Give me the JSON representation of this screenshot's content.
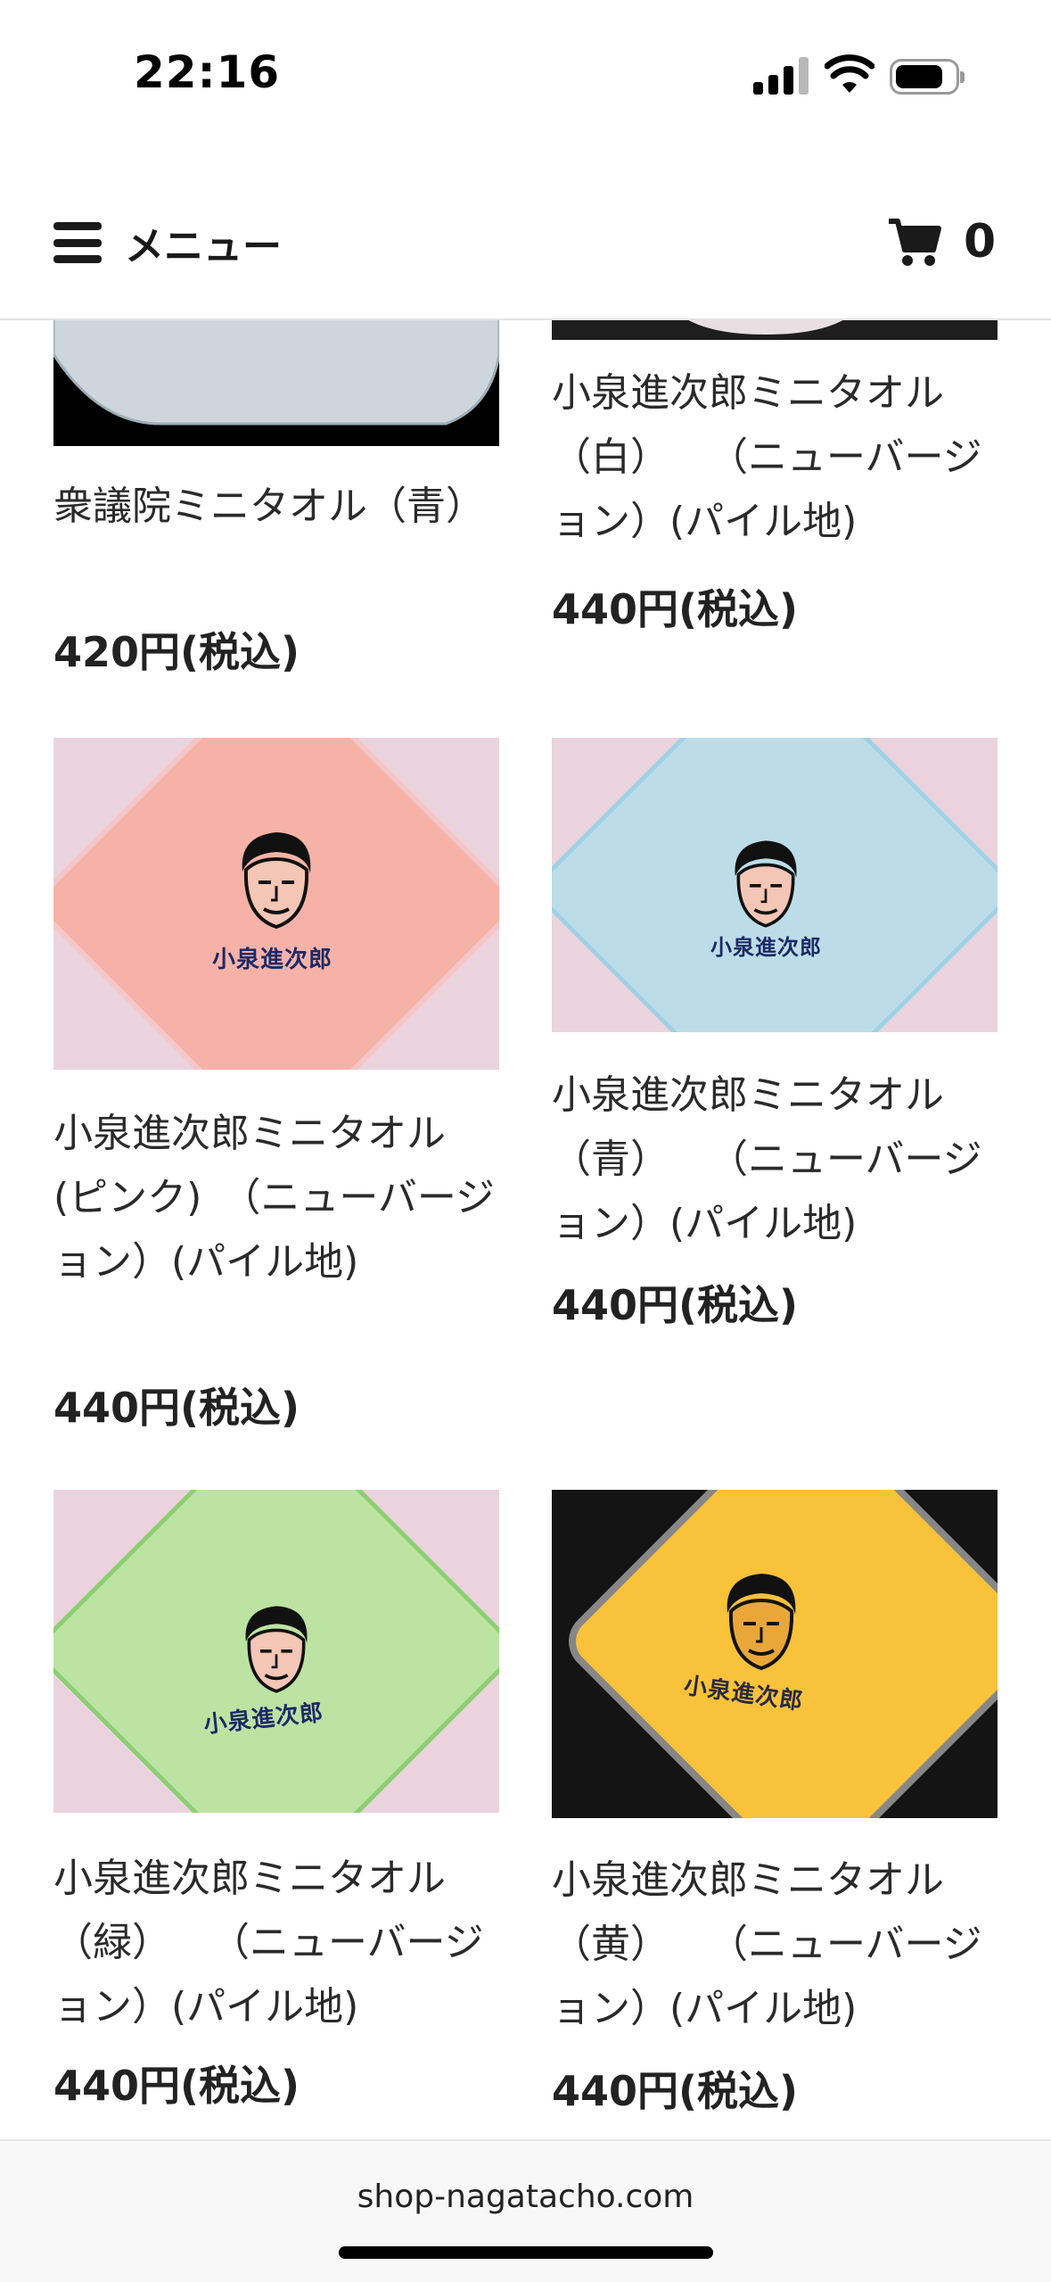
{
  "status": {
    "time": "22:16"
  },
  "header": {
    "menu_label": "メニュー",
    "cart_count": "0"
  },
  "products": [
    {
      "name": "衆議院ミニタオル（青）",
      "price": "420円(税込)"
    },
    {
      "name": "小泉進次郎ミニタオル（白）　　（ニューバージョン）(パイル地)",
      "price": "440円(税込)"
    },
    {
      "name": "小泉進次郎ミニタオル(ピンク)　（ニューバージョン）(パイル地)",
      "price": "440円(税込)",
      "embroidery": "小泉進次郎"
    },
    {
      "name": "小泉進次郎ミニタオル（青）　　（ニューバージョン）(パイル地)",
      "price": "440円(税込)",
      "embroidery": "小泉進次郎"
    },
    {
      "name": "小泉進次郎ミニタオル（緑）　　（ニューバージョン）(パイル地)",
      "price": "440円(税込)",
      "embroidery": "小泉進次郎"
    },
    {
      "name": "小泉進次郎ミニタオル（黄）　　（ニューバージョン）(パイル地)",
      "price": "440円(税込)",
      "embroidery": "小泉進次郎"
    }
  ],
  "footer": {
    "url": "shop-nagatacho.com"
  },
  "colors": {
    "pink_towel": "#f7b2a8",
    "blue_towel": "#bcdde8",
    "green_towel": "#bde3a2",
    "yellow_towel": "#f8c23a",
    "photo_bg": "#ead3dc",
    "dark_bg": "#141414"
  }
}
